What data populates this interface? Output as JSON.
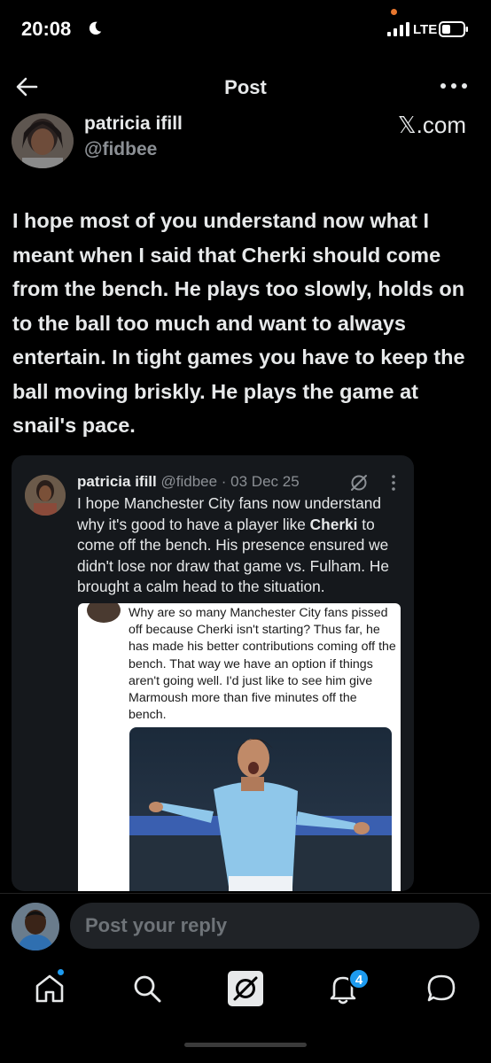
{
  "status_bar": {
    "time": "20:08",
    "network": "LTE"
  },
  "nav": {
    "title": "Post"
  },
  "post": {
    "author_name": "patricia ifill",
    "author_handle": "@fidbee",
    "source": "𝕏.com",
    "text": "I hope most of you understand now what I meant when I said that Cherki should come from the bench. He plays too slowly, holds on to the ball too much and want to always entertain. In tight games you have to keep the ball moving briskly. He plays the game at snail's pace."
  },
  "quoted": {
    "author_name": "patricia ifill",
    "meta": "@fidbee · 03 Dec 25",
    "text_before": "I hope Manchester City fans now understand why it's good to have a player like ",
    "text_bold": "Cherki",
    "text_after": " to come off the bench. His presence ensured we didn't lose nor draw that game vs. Fulham. He brought a calm head to the situation.",
    "inner_text": "Why are so many Manchester City fans pissed off because Cherki isn't starting? Thus far, he has made his better contributions coming off the bench. That way we have an option if things aren't going well. I'd just like to see him give Marmoush more than five minutes off the bench."
  },
  "reply": {
    "placeholder": "Post your reply"
  },
  "tabs": {
    "notifications_badge": "4"
  },
  "colors": {
    "accent": "#1d9bf0",
    "background": "#000000",
    "card": "#15181c",
    "muted": "#8b8f94"
  }
}
